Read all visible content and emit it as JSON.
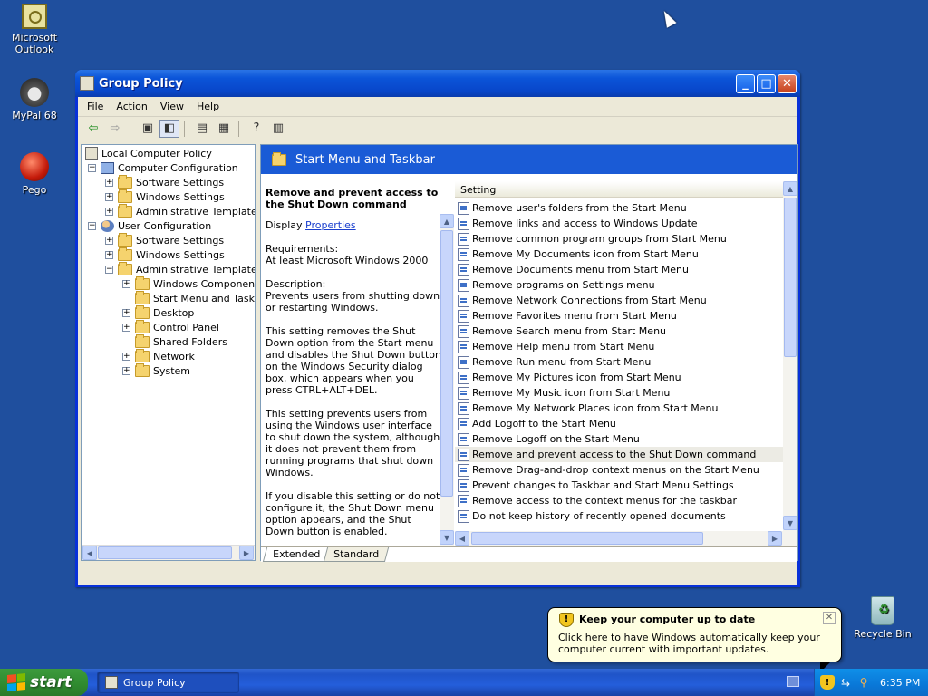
{
  "desktop": {
    "icons": [
      {
        "label": "Microsoft Outlook"
      },
      {
        "label": "MyPal 68"
      },
      {
        "label": "Pego"
      },
      {
        "label": "Recycle Bin"
      }
    ]
  },
  "window": {
    "title": "Group Policy",
    "menu": [
      "File",
      "Action",
      "View",
      "Help"
    ]
  },
  "tree": {
    "items": [
      {
        "label": "Local Computer Policy"
      },
      {
        "label": "Computer Configuration"
      },
      {
        "label": "Software Settings"
      },
      {
        "label": "Windows Settings"
      },
      {
        "label": "Administrative Templates"
      },
      {
        "label": "User Configuration"
      },
      {
        "label": "Software Settings"
      },
      {
        "label": "Windows Settings"
      },
      {
        "label": "Administrative Templates"
      },
      {
        "label": "Windows Components"
      },
      {
        "label": "Start Menu and Taskba"
      },
      {
        "label": "Desktop"
      },
      {
        "label": "Control Panel"
      },
      {
        "label": "Shared Folders"
      },
      {
        "label": "Network"
      },
      {
        "label": "System"
      }
    ]
  },
  "details": {
    "header": "Start Menu and Taskbar",
    "desc_title": "Remove and prevent access to the Shut Down command",
    "display_prefix": "Display",
    "properties_link": "Properties",
    "requirements_label": "Requirements:",
    "requirements": "At least Microsoft Windows 2000",
    "description_label": "Description:",
    "paragraphs": [
      "Prevents users from shutting down or restarting Windows.",
      "This setting removes the Shut Down option from the Start menu and disables the Shut Down button on the Windows Security dialog box, which appears when you press CTRL+ALT+DEL.",
      "This setting prevents users from using the Windows user interface to shut down the system, although it does not prevent them from running programs that shut down Windows.",
      "If you disable this setting or do not configure it, the Shut Down menu option appears, and the Shut Down button is enabled."
    ],
    "column_header": "Setting",
    "settings": [
      "Remove user's folders from the Start Menu",
      "Remove links and access to Windows Update",
      "Remove common program groups from Start Menu",
      "Remove My Documents icon from Start Menu",
      "Remove Documents menu from Start Menu",
      "Remove programs on Settings menu",
      "Remove Network Connections from Start Menu",
      "Remove Favorites menu from Start Menu",
      "Remove Search menu from Start Menu",
      "Remove Help menu from Start Menu",
      "Remove Run menu from Start Menu",
      "Remove My Pictures icon from Start Menu",
      "Remove My Music icon from Start Menu",
      "Remove My Network Places icon from Start Menu",
      "Add Logoff to the Start Menu",
      "Remove Logoff on the Start Menu",
      "Remove and prevent access to the Shut Down command",
      "Remove Drag-and-drop context menus on the Start Menu",
      "Prevent changes to Taskbar and Start Menu Settings",
      "Remove access to the context menus for the taskbar",
      "Do not keep history of recently opened documents"
    ],
    "tabs": [
      "Extended",
      "Standard"
    ]
  },
  "balloon": {
    "title": "Keep your computer up to date",
    "body": "Click here to have Windows automatically keep your computer current with important updates."
  },
  "taskbar": {
    "start_label": "start",
    "task_label": "Group Policy",
    "clock": "6:35 PM"
  }
}
